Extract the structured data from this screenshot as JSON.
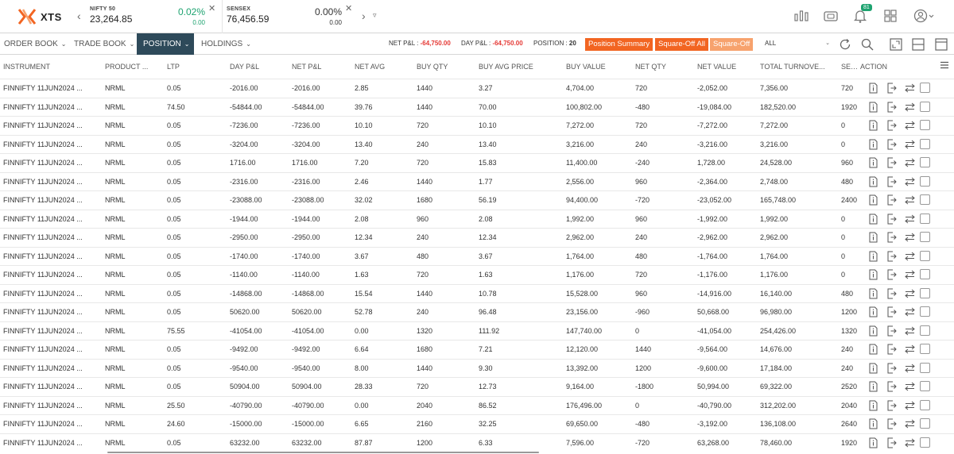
{
  "app": {
    "logo_text": "XTS",
    "brand_color": "#f26522"
  },
  "ticker": [
    {
      "name": "NIFTY 50",
      "value": "23,264.85",
      "change_pct": "0.02%",
      "change_abs": "0.00"
    },
    {
      "name": "SENSEX",
      "value": "76,456.59",
      "change_pct": "0.00%",
      "change_abs": "0.00"
    }
  ],
  "notification_count": "81",
  "tabs": [
    {
      "label": "ORDER BOOK",
      "active": false
    },
    {
      "label": "TRADE BOOK",
      "active": false
    },
    {
      "label": "POSITION",
      "active": true
    },
    {
      "label": "HOLDINGS",
      "active": false
    }
  ],
  "summary": {
    "net_pnl_label": "NET P&L : ",
    "net_pnl_value": "-64,750.00",
    "day_pnl_label": "DAY P&L : ",
    "day_pnl_value": "-64,750.00",
    "position_label": "POSITION : ",
    "position_value": "20"
  },
  "buttons": {
    "position_summary": "Position Summary",
    "square_off_all": "Square-Off All",
    "square_off": "Square-Off"
  },
  "filter": {
    "selected": "ALL"
  },
  "columns": [
    "INSTRUMENT",
    "PRODUCT ...",
    "LTP",
    "DAY P&L",
    "NET P&L",
    "NET AVG",
    "BUY QTY",
    "BUY AVG PRICE",
    "BUY VALUE",
    "NET QTY",
    "NET VALUE",
    "TOTAL TURNOVE...",
    "SELL Q",
    "ACTION"
  ],
  "rows": [
    [
      "FINNIFTY 11JUN2024 ...",
      "NRML",
      "0.05",
      "-2016.00",
      "-2016.00",
      "2.85",
      "1440",
      "3.27",
      "4,704.00",
      "720",
      "-2,052.00",
      "7,356.00",
      "720"
    ],
    [
      "FINNIFTY 11JUN2024 ...",
      "NRML",
      "74.50",
      "-54844.00",
      "-54844.00",
      "39.76",
      "1440",
      "70.00",
      "100,802.00",
      "-480",
      "-19,084.00",
      "182,520.00",
      "1920"
    ],
    [
      "FINNIFTY 11JUN2024 ...",
      "NRML",
      "0.05",
      "-7236.00",
      "-7236.00",
      "10.10",
      "720",
      "10.10",
      "7,272.00",
      "720",
      "-7,272.00",
      "7,272.00",
      "0"
    ],
    [
      "FINNIFTY 11JUN2024 ...",
      "NRML",
      "0.05",
      "-3204.00",
      "-3204.00",
      "13.40",
      "240",
      "13.40",
      "3,216.00",
      "240",
      "-3,216.00",
      "3,216.00",
      "0"
    ],
    [
      "FINNIFTY 11JUN2024 ...",
      "NRML",
      "0.05",
      "1716.00",
      "1716.00",
      "7.20",
      "720",
      "15.83",
      "11,400.00",
      "-240",
      "1,728.00",
      "24,528.00",
      "960"
    ],
    [
      "FINNIFTY 11JUN2024 ...",
      "NRML",
      "0.05",
      "-2316.00",
      "-2316.00",
      "2.46",
      "1440",
      "1.77",
      "2,556.00",
      "960",
      "-2,364.00",
      "2,748.00",
      "480"
    ],
    [
      "FINNIFTY 11JUN2024 ...",
      "NRML",
      "0.05",
      "-23088.00",
      "-23088.00",
      "32.02",
      "1680",
      "56.19",
      "94,400.00",
      "-720",
      "-23,052.00",
      "165,748.00",
      "2400"
    ],
    [
      "FINNIFTY 11JUN2024 ...",
      "NRML",
      "0.05",
      "-1944.00",
      "-1944.00",
      "2.08",
      "960",
      "2.08",
      "1,992.00",
      "960",
      "-1,992.00",
      "1,992.00",
      "0"
    ],
    [
      "FINNIFTY 11JUN2024 ...",
      "NRML",
      "0.05",
      "-2950.00",
      "-2950.00",
      "12.34",
      "240",
      "12.34",
      "2,962.00",
      "240",
      "-2,962.00",
      "2,962.00",
      "0"
    ],
    [
      "FINNIFTY 11JUN2024 ...",
      "NRML",
      "0.05",
      "-1740.00",
      "-1740.00",
      "3.67",
      "480",
      "3.67",
      "1,764.00",
      "480",
      "-1,764.00",
      "1,764.00",
      "0"
    ],
    [
      "FINNIFTY 11JUN2024 ...",
      "NRML",
      "0.05",
      "-1140.00",
      "-1140.00",
      "1.63",
      "720",
      "1.63",
      "1,176.00",
      "720",
      "-1,176.00",
      "1,176.00",
      "0"
    ],
    [
      "FINNIFTY 11JUN2024 ...",
      "NRML",
      "0.05",
      "-14868.00",
      "-14868.00",
      "15.54",
      "1440",
      "10.78",
      "15,528.00",
      "960",
      "-14,916.00",
      "16,140.00",
      "480"
    ],
    [
      "FINNIFTY 11JUN2024 ...",
      "NRML",
      "0.05",
      "50620.00",
      "50620.00",
      "52.78",
      "240",
      "96.48",
      "23,156.00",
      "-960",
      "50,668.00",
      "96,980.00",
      "1200"
    ],
    [
      "FINNIFTY 11JUN2024 ...",
      "NRML",
      "75.55",
      "-41054.00",
      "-41054.00",
      "0.00",
      "1320",
      "111.92",
      "147,740.00",
      "0",
      "-41,054.00",
      "254,426.00",
      "1320"
    ],
    [
      "FINNIFTY 11JUN2024 ...",
      "NRML",
      "0.05",
      "-9492.00",
      "-9492.00",
      "6.64",
      "1680",
      "7.21",
      "12,120.00",
      "1440",
      "-9,564.00",
      "14,676.00",
      "240"
    ],
    [
      "FINNIFTY 11JUN2024 ...",
      "NRML",
      "0.05",
      "-9540.00",
      "-9540.00",
      "8.00",
      "1440",
      "9.30",
      "13,392.00",
      "1200",
      "-9,600.00",
      "17,184.00",
      "240"
    ],
    [
      "FINNIFTY 11JUN2024 ...",
      "NRML",
      "0.05",
      "50904.00",
      "50904.00",
      "28.33",
      "720",
      "12.73",
      "9,164.00",
      "-1800",
      "50,994.00",
      "69,322.00",
      "2520"
    ],
    [
      "FINNIFTY 11JUN2024 ...",
      "NRML",
      "25.50",
      "-40790.00",
      "-40790.00",
      "0.00",
      "2040",
      "86.52",
      "176,496.00",
      "0",
      "-40,790.00",
      "312,202.00",
      "2040"
    ],
    [
      "FINNIFTY 11JUN2024 ...",
      "NRML",
      "24.60",
      "-15000.00",
      "-15000.00",
      "6.65",
      "2160",
      "32.25",
      "69,650.00",
      "-480",
      "-3,192.00",
      "136,108.00",
      "2640"
    ],
    [
      "FINNIFTY 11JUN2024 ...",
      "NRML",
      "0.05",
      "63232.00",
      "63232.00",
      "87.87",
      "1200",
      "6.33",
      "7,596.00",
      "-720",
      "63,268.00",
      "78,460.00",
      "1920"
    ]
  ],
  "icons": {
    "header": [
      "chart-bars-icon",
      "wallet-icon",
      "bell-icon",
      "grid-icon",
      "user-icon"
    ],
    "toolbar": [
      "refresh-icon",
      "search-icon",
      "expand-icon",
      "layout-icon",
      "window-icon"
    ],
    "row_actions": [
      "info-doc-icon",
      "exit-icon",
      "convert-icon"
    ]
  }
}
